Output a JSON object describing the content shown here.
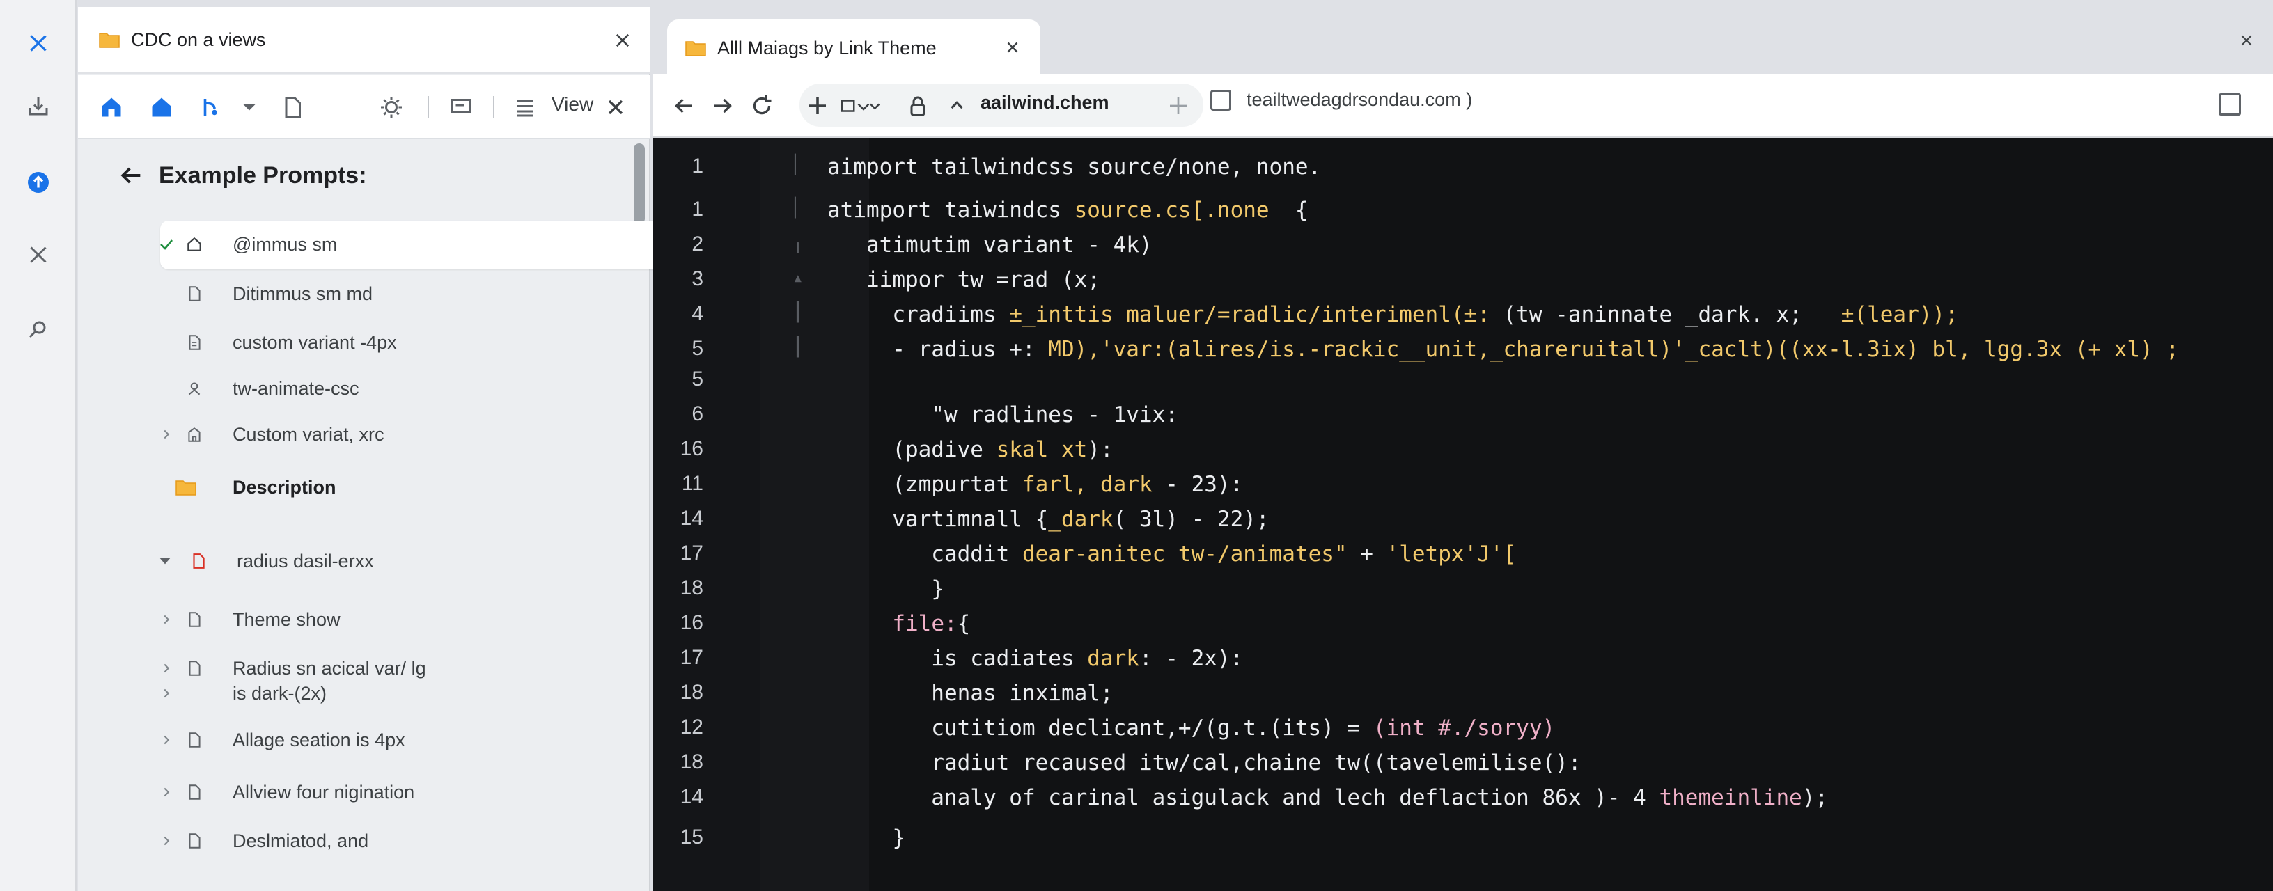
{
  "rail": {
    "icons": [
      "close-icon",
      "download-icon",
      "upload-icon",
      "tools-icon",
      "settings-icon"
    ]
  },
  "sidebar": {
    "tab_title": "CDC on a views",
    "toolbar_view_label": "View",
    "heading": "Example Prompts:",
    "items": [
      {
        "label": "@immus sm",
        "icon": "home-icon",
        "indicator": "check",
        "selected": true
      },
      {
        "label": "Ditimmus sm  md",
        "icon": "file-icon",
        "indicator": ""
      },
      {
        "label": "custom variant -4px",
        "icon": "file-icon",
        "indicator": ""
      },
      {
        "label": "tw-animate-csc",
        "icon": "person-icon",
        "indicator": ""
      },
      {
        "label": "Custom variat, xrc",
        "icon": "building-icon",
        "indicator": "chevron"
      },
      {
        "label": "Description",
        "icon": "folder-icon",
        "indicator": ""
      },
      {
        "label": "radius dasil-erxx",
        "icon": "file-icon-red",
        "indicator": "caret-down"
      },
      {
        "label": "Theme show",
        "icon": "file-icon",
        "indicator": "chevron"
      },
      {
        "label": "Radius sn acical var/ lg",
        "icon": "file-icon",
        "indicator": "chevron"
      },
      {
        "label": "is dark-(2x)",
        "icon": "",
        "indicator": "chevron"
      },
      {
        "label": "Allage seation is 4px",
        "icon": "file-icon",
        "indicator": "chevron"
      },
      {
        "label": "Allview four nigination",
        "icon": "file-icon",
        "indicator": "chevron"
      },
      {
        "label": "Deslmiatod, and",
        "icon": "file-icon",
        "indicator": "chevron"
      }
    ]
  },
  "browser": {
    "tab_title": "Alll Maiags by Link Theme",
    "url": "aailwind.chem",
    "second_url": "teailtwedagdrsondau.com )"
  },
  "editor": {
    "lines": [
      {
        "num": "1",
        "segments": [
          {
            "t": "aimport tailwindcss source/none, none.",
            "c": ""
          }
        ]
      },
      {
        "num": "1",
        "segments": [
          {
            "t": "atimport taiwindcs ",
            "c": ""
          },
          {
            "t": "source.cs[.none",
            "c": "yel"
          },
          {
            "t": "  {",
            "c": ""
          }
        ]
      },
      {
        "num": "2",
        "segments": [
          {
            "t": "   atimutim variant - 4k)",
            "c": ""
          }
        ]
      },
      {
        "num": "3",
        "segments": [
          {
            "t": "   iimpor tw =rad (x;",
            "c": ""
          }
        ]
      },
      {
        "num": "4",
        "segments": [
          {
            "t": "     cradiims ",
            "c": ""
          },
          {
            "t": "±_inttis maluer/=radlic/interimenl(±:",
            "c": "yel"
          },
          {
            "t": " (tw -aninnate _dark. x;   ",
            "c": ""
          },
          {
            "t": "±(lear));",
            "c": "yel"
          }
        ]
      },
      {
        "num": "5",
        "segments": [
          {
            "t": "     - radius +: ",
            "c": ""
          },
          {
            "t": "MD),'var:(alires/is.-rackic__unit,_chareruitall)'_caclt)((xx-l.3ix) bl, lgg.3x (+ xl) ;",
            "c": "yel"
          }
        ]
      },
      {
        "num": "5",
        "segments": [
          {
            "t": "",
            "c": ""
          }
        ]
      },
      {
        "num": "6",
        "segments": [
          {
            "t": "        \"w radlines - 1vix:",
            "c": ""
          }
        ]
      },
      {
        "num": "16",
        "segments": [
          {
            "t": "     (padive ",
            "c": ""
          },
          {
            "t": "skal xt",
            "c": "yel"
          },
          {
            "t": "):",
            "c": ""
          }
        ]
      },
      {
        "num": "11",
        "segments": [
          {
            "t": "     (zmpurtat ",
            "c": ""
          },
          {
            "t": "farl, dark",
            "c": "yel"
          },
          {
            "t": " - 23):",
            "c": ""
          }
        ]
      },
      {
        "num": "14",
        "segments": [
          {
            "t": "     vartimnall {",
            "c": ""
          },
          {
            "t": "_dark",
            "c": "yel"
          },
          {
            "t": "( 3l) - 22);",
            "c": ""
          }
        ]
      },
      {
        "num": "17",
        "segments": [
          {
            "t": "        caddit ",
            "c": ""
          },
          {
            "t": "dear-anitec tw-/animates\"",
            "c": "yel"
          },
          {
            "t": " + ",
            "c": ""
          },
          {
            "t": "'letpx'J'[",
            "c": "yel"
          }
        ]
      },
      {
        "num": "18",
        "segments": [
          {
            "t": "        }",
            "c": ""
          }
        ]
      },
      {
        "num": "16",
        "segments": [
          {
            "t": "     ",
            "c": ""
          },
          {
            "t": "file:",
            "c": "pink"
          },
          {
            "t": "{",
            "c": ""
          }
        ]
      },
      {
        "num": "17",
        "segments": [
          {
            "t": "        is cadiates ",
            "c": ""
          },
          {
            "t": "dark",
            "c": "yel"
          },
          {
            "t": ": - 2x):",
            "c": ""
          }
        ]
      },
      {
        "num": "18",
        "segments": [
          {
            "t": "        henas inximal;",
            "c": ""
          }
        ]
      },
      {
        "num": "12",
        "segments": [
          {
            "t": "        cutitiom declicant,+/(g.t.(its) = ",
            "c": ""
          },
          {
            "t": "(int #./soryy)",
            "c": "pink"
          }
        ]
      },
      {
        "num": "18",
        "segments": [
          {
            "t": "        radiut recaused itw/cal,chaine tw((tavelemilise():",
            "c": ""
          }
        ]
      },
      {
        "num": "14",
        "segments": [
          {
            "t": "        analy of carinal asigulack and lech deflaction 86x )- 4 ",
            "c": ""
          },
          {
            "t": "themeinline",
            "c": "pink"
          },
          {
            "t": ");",
            "c": ""
          }
        ]
      },
      {
        "num": "15",
        "segments": [
          {
            "t": "     }",
            "c": ""
          }
        ]
      }
    ]
  }
}
